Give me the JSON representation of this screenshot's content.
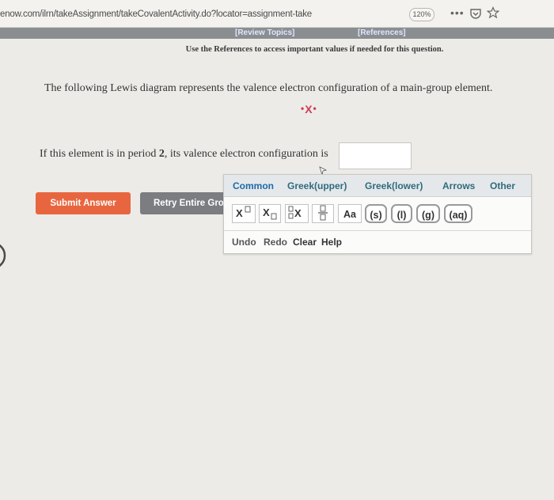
{
  "browser": {
    "url": "enow.com/ilrn/takeAssignment/takeCovalentActivity.do?locator=assignment-take",
    "zoom": "120%",
    "menu_glyph": "•••"
  },
  "refbar": {
    "review_label": "[Review Topics]",
    "references_label": "[References]"
  },
  "notice": "Use the References to access important values if needed for this question.",
  "question": {
    "text1": "The following Lewis diagram represents the valence electron configuration of a main-group element.",
    "lewis_symbol": "X",
    "text2_prefix": "If this element is in period ",
    "period": "2",
    "text2_suffix": ", its valence electron configuration is",
    "answer_value": ""
  },
  "buttons": {
    "submit": "Submit Answer",
    "retry": "Retry Entire Group"
  },
  "palette": {
    "tabs": [
      "Common",
      "Greek(upper)",
      "Greek(lower)",
      "Arrows",
      "Other"
    ],
    "aa": "Aa",
    "states": [
      "(s)",
      "(l)",
      "(g)",
      "(aq)"
    ],
    "actions": [
      "Undo",
      "Redo",
      "Clear",
      "Help"
    ]
  },
  "colors": {
    "submit_bg": "#e8663f",
    "retry_bg": "#7b7d80",
    "lewis_color": "#d23b55",
    "tab_color": "#2f6b7e"
  }
}
